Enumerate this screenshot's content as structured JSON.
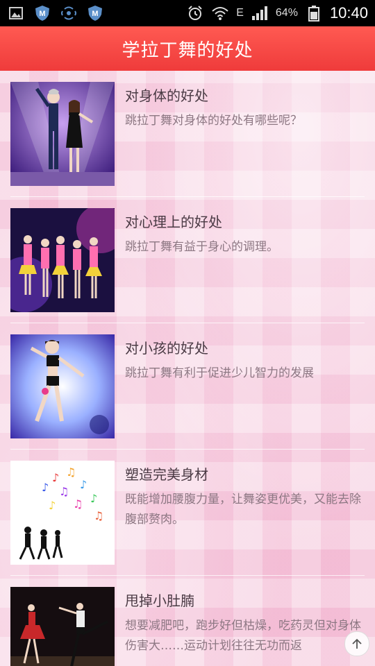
{
  "status": {
    "left_icons": [
      "image-icon",
      "shield-m-icon",
      "wifi-hotspot-icon",
      "shield-m-icon"
    ],
    "network": "E",
    "battery": "64%",
    "time": "10:40"
  },
  "header": {
    "title": "学拉丁舞的好处"
  },
  "items": [
    {
      "title": "对身体的好处",
      "desc": "跳拉丁舞对身体的好处有哪些呢？",
      "thumb": "dancing-couple-image"
    },
    {
      "title": "对心理上的好处",
      "desc": "跳拉丁舞有益于身心的调理。",
      "thumb": "group-dancers-image"
    },
    {
      "title": "对小孩的好处",
      "desc": "跳拉丁舞有利于促进少儿智力的发展",
      "thumb": "child-dancer-image"
    },
    {
      "title": "塑造完美身材",
      "desc": "既能增加腰腹力量，让舞姿更优美，又能去除腹部赘肉。",
      "thumb": "music-notes-silhouettes-image"
    },
    {
      "title": "甩掉小肚腩",
      "desc": "想要减肥吧，跑步好但枯燥，吃药灵但对身体伤害大……运动计划往往无功而返",
      "thumb": "stage-dancers-image"
    }
  ],
  "colors": {
    "header": "#ef3b3b",
    "title_text": "#4a3a44",
    "desc_text": "#8d7783"
  }
}
